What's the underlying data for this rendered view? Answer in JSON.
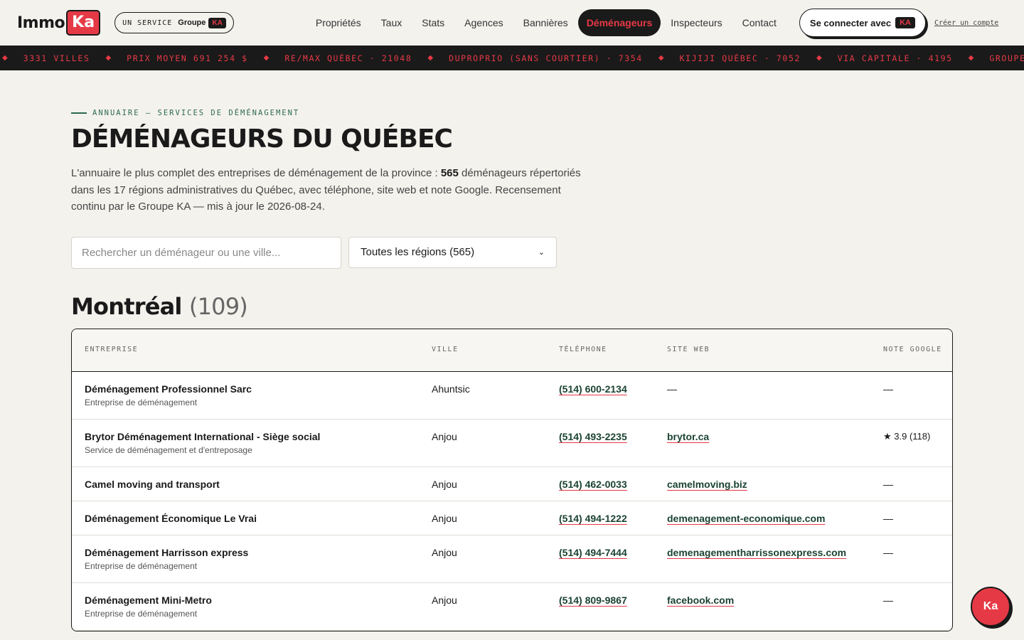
{
  "header": {
    "logo_immo": "Immo",
    "logo_ka": "Ka",
    "service_label": "UN SERVICE",
    "service_group": "Groupe",
    "service_ka": "KA",
    "nav": [
      "Propriétés",
      "Taux",
      "Stats",
      "Agences",
      "Bannières",
      "Déménageurs",
      "Inspecteurs",
      "Contact"
    ],
    "active_nav": "Déménageurs",
    "connect_label": "Se connecter avec",
    "connect_ka": "KA",
    "create_account": "Créer un compte"
  },
  "ticker": [
    "3331 VILLES",
    "PRIX MOYEN 691 254 $",
    "RE/MAX QUÉBEC · 21048",
    "DUPROPRIO (SANS COURTIER) · 7354",
    "KIJIJI QUÉBEC · 7052",
    "VIA CAPITALE · 4195",
    "GROUPE SUTTON"
  ],
  "page": {
    "eyebrow": "ANNUAIRE — SERVICES DE DÉMÉNAGEMENT",
    "title": "DÉMÉNAGEURS DU QUÉBEC",
    "intro_pre": "L'annuaire le plus complet des entreprises de déménagement de la province : ",
    "intro_count": "565",
    "intro_post": " déménageurs répertoriés dans les 17 régions administratives du Québec, avec téléphone, site web et note Google. Recensement continu par le Groupe KA — mis à jour le 2026-08-24.",
    "search_placeholder": "Rechercher un déménageur ou une ville...",
    "region_select": "Toutes les régions (565)"
  },
  "region": {
    "name": "Montréal",
    "count": "(109)"
  },
  "table": {
    "headers": [
      "ENTREPRISE",
      "VILLE",
      "TÉLÉPHONE",
      "SITE WEB",
      "NOTE GOOGLE"
    ],
    "rows": [
      {
        "name": "Déménagement Professionnel Sarc",
        "sub": "Entreprise de déménagement",
        "ville": "Ahuntsic",
        "tel": "(514) 600-2134",
        "web": "—",
        "note": "—"
      },
      {
        "name": "Brytor Déménagement International - Siège social",
        "sub": "Service de déménagement et d'entreposage",
        "ville": "Anjou",
        "tel": "(514) 493-2235",
        "web": "brytor.ca",
        "note": "★ 3.9 (118)"
      },
      {
        "name": "Camel moving and transport",
        "sub": "",
        "ville": "Anjou",
        "tel": "(514) 462-0033",
        "web": "camelmoving.biz",
        "note": "—"
      },
      {
        "name": "Déménagement Économique Le Vrai",
        "sub": "",
        "ville": "Anjou",
        "tel": "(514) 494-1222",
        "web": "demenagement-economique.com",
        "note": "—"
      },
      {
        "name": "Déménagement Harrisson express",
        "sub": "Entreprise de déménagement",
        "ville": "Anjou",
        "tel": "(514) 494-7444",
        "web": "demenagementharrissonexpress.com",
        "note": "—"
      },
      {
        "name": "Déménagement Mini-Metro",
        "sub": "Entreprise de déménagement",
        "ville": "Anjou",
        "tel": "(514) 809-9867",
        "web": "facebook.com",
        "note": "—"
      }
    ]
  },
  "fab_label": "Ka"
}
